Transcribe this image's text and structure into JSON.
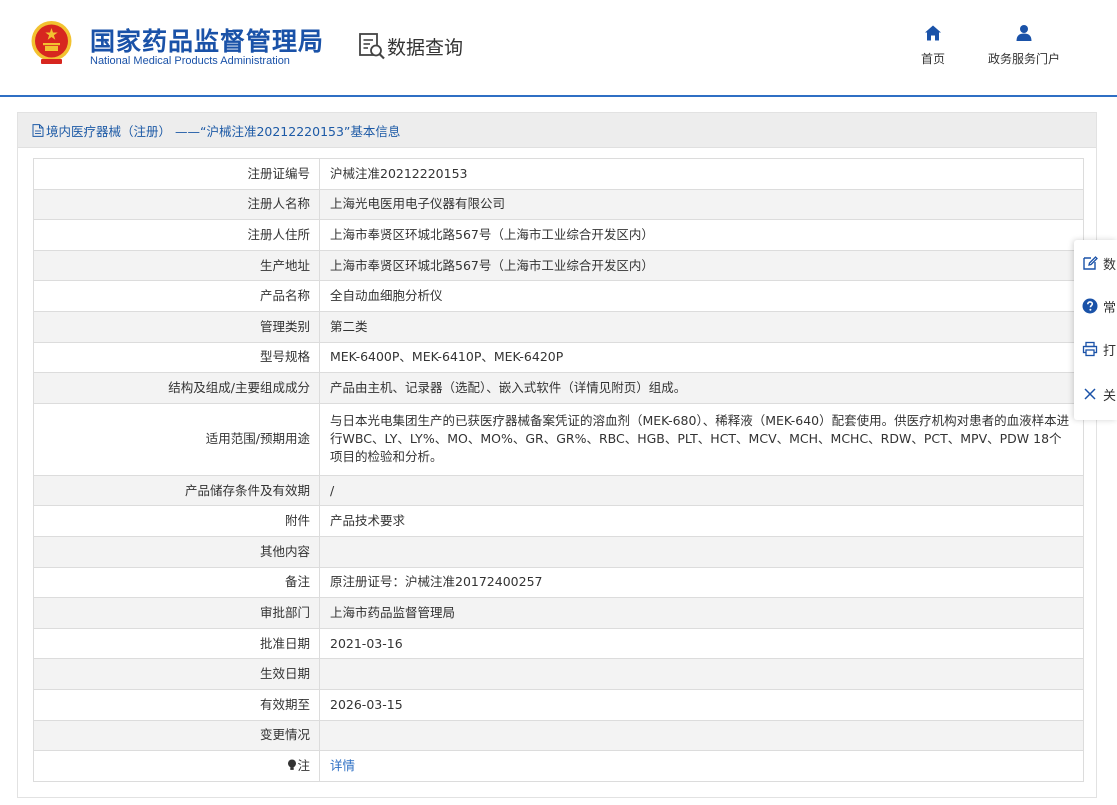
{
  "header": {
    "org_cn": "国家药品监督管理局",
    "org_en": "National Medical Products Administration",
    "section": "数据查询",
    "nav": [
      {
        "label": "首页",
        "icon": "home-icon"
      },
      {
        "label": "政务服务门户",
        "icon": "user-icon"
      }
    ]
  },
  "panel": {
    "title": "境内医疗器械（注册） ——“沪械注准20212220153”基本信息"
  },
  "rows": [
    {
      "label": "注册证编号",
      "value": "沪械注准20212220153"
    },
    {
      "label": "注册人名称",
      "value": "上海光电医用电子仪器有限公司"
    },
    {
      "label": "注册人住所",
      "value": "上海市奉贤区环城北路567号（上海市工业综合开发区内）"
    },
    {
      "label": "生产地址",
      "value": "上海市奉贤区环城北路567号（上海市工业综合开发区内）"
    },
    {
      "label": "产品名称",
      "value": "全自动血细胞分析仪"
    },
    {
      "label": "管理类别",
      "value": "第二类"
    },
    {
      "label": "型号规格",
      "value": "MEK-6400P、MEK-6410P、MEK-6420P"
    },
    {
      "label": "结构及组成/主要组成成分",
      "value": "产品由主机、记录器（选配）、嵌入式软件（详情见附页）组成。"
    },
    {
      "label": "适用范围/预期用途",
      "value": "与日本光电集团生产的已获医疗器械备案凭证的溶血剂（MEK-680）、稀释液（MEK-640）配套使用。供医疗机构对患者的血液样本进行WBC、LY、LY%、MO、MO%、GR、GR%、RBC、HGB、PLT、HCT、MCV、MCH、MCHC、RDW、PCT、MPV、PDW 18个项目的检验和分析。"
    },
    {
      "label": "产品储存条件及有效期",
      "value": "/"
    },
    {
      "label": "附件",
      "value": "产品技术要求"
    },
    {
      "label": "其他内容",
      "value": ""
    },
    {
      "label": "备注",
      "value": "原注册证号：沪械注准20172400257"
    },
    {
      "label": "审批部门",
      "value": "上海市药品监督管理局"
    },
    {
      "label": "批准日期",
      "value": "2021-03-16"
    },
    {
      "label": "生效日期",
      "value": ""
    },
    {
      "label": "有效期至",
      "value": "2026-03-15"
    },
    {
      "label": "变更情况",
      "value": ""
    },
    {
      "label": "注",
      "value": "详情"
    }
  ],
  "side_tools": [
    {
      "label": "数",
      "icon": "edit-icon"
    },
    {
      "label": "常",
      "icon": "help-icon"
    },
    {
      "label": "打",
      "icon": "print-icon"
    },
    {
      "label": "关",
      "icon": "close-icon"
    }
  ],
  "colors": {
    "brand_blue": "#1a52a8",
    "link_blue": "#2d6fc4",
    "emblem_red": "#d7261f",
    "emblem_gold": "#f2c230"
  }
}
